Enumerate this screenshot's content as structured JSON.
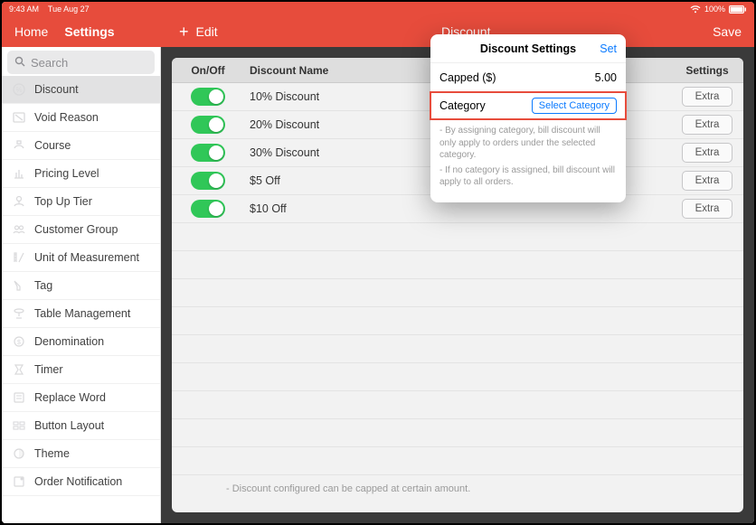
{
  "statusbar": {
    "time": "9:43 AM",
    "date": "Tue Aug 27",
    "battery": "100%"
  },
  "header": {
    "home": "Home",
    "settings": "Settings",
    "edit": "Edit",
    "title": "Discount",
    "save": "Save"
  },
  "search": {
    "placeholder": "Search"
  },
  "sidebar": {
    "items": [
      {
        "label": "Discount",
        "active": true
      },
      {
        "label": "Void Reason"
      },
      {
        "label": "Course"
      },
      {
        "label": "Pricing Level"
      },
      {
        "label": "Top Up Tier"
      },
      {
        "label": "Customer Group"
      },
      {
        "label": "Unit of Measurement"
      },
      {
        "label": "Tag"
      },
      {
        "label": "Table Management"
      },
      {
        "label": "Denomination"
      },
      {
        "label": "Timer"
      },
      {
        "label": "Replace Word"
      },
      {
        "label": "Button Layout"
      },
      {
        "label": "Theme"
      },
      {
        "label": "Order Notification"
      }
    ]
  },
  "table": {
    "headers": {
      "onoff": "On/Off",
      "name": "Discount Name",
      "settings": "Settings"
    },
    "extra": "Extra",
    "rows": [
      {
        "name": "10% Discount"
      },
      {
        "name": "20% Discount"
      },
      {
        "name": "30% Discount"
      },
      {
        "name": "$5 Off"
      },
      {
        "name": "$10 Off"
      }
    ],
    "footer": "- Discount configured can be capped at certain amount."
  },
  "popover": {
    "title": "Discount Settings",
    "set": "Set",
    "capped_label": "Capped ($)",
    "capped_value": "5.00",
    "category_label": "Category",
    "select_category": "Select Category",
    "note1": "- By assigning category, bill discount will only apply to orders under the selected category.",
    "note2": "- If no category is assigned, bill discount will apply to all orders."
  }
}
